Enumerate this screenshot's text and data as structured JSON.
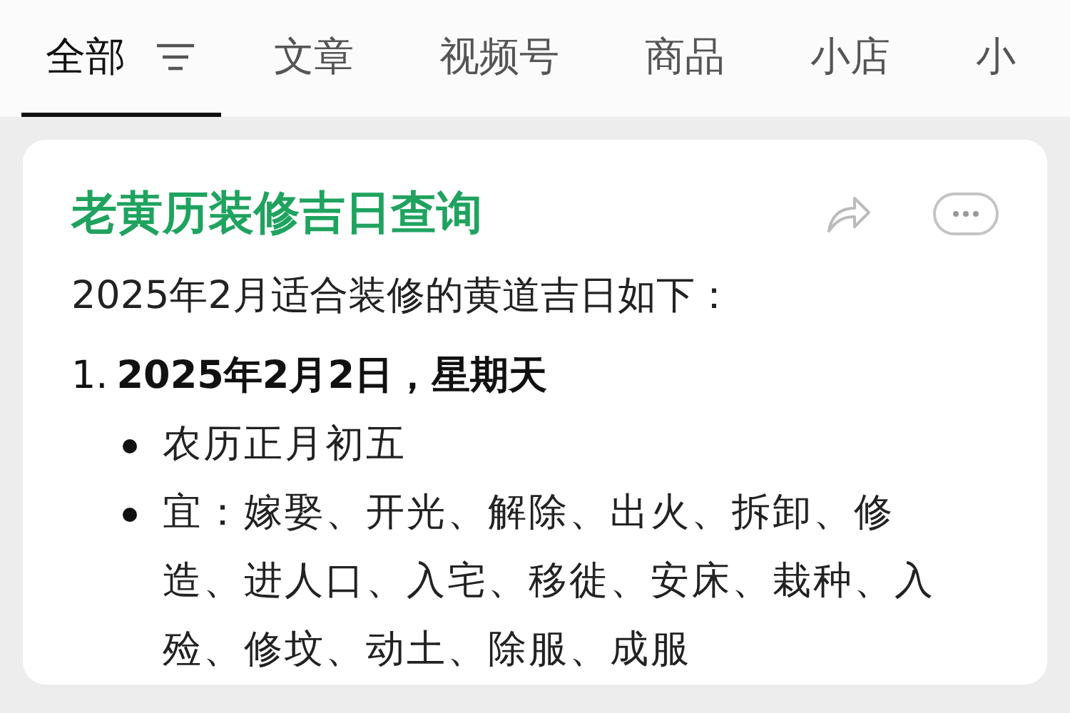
{
  "tabs": [
    {
      "label": "全部",
      "selected": true
    },
    {
      "label": "文章",
      "selected": false
    },
    {
      "label": "视频号",
      "selected": false
    },
    {
      "label": "商品",
      "selected": false
    },
    {
      "label": "小店",
      "selected": false
    },
    {
      "label": "小",
      "selected": false
    }
  ],
  "result": {
    "title": "老黄历装修吉日查询",
    "intro": "2025年2月适合装修的黄道吉日如下：",
    "items": [
      {
        "number": "1.",
        "heading": "2025年2月2日，星期天",
        "bullets": [
          "农历正月初五",
          "宜：嫁娶、开光、解除、出火、拆卸、修造、进人口、入宅、移徙、安床、栽种、入殓、修坟、动土、除服、成服"
        ]
      }
    ]
  }
}
